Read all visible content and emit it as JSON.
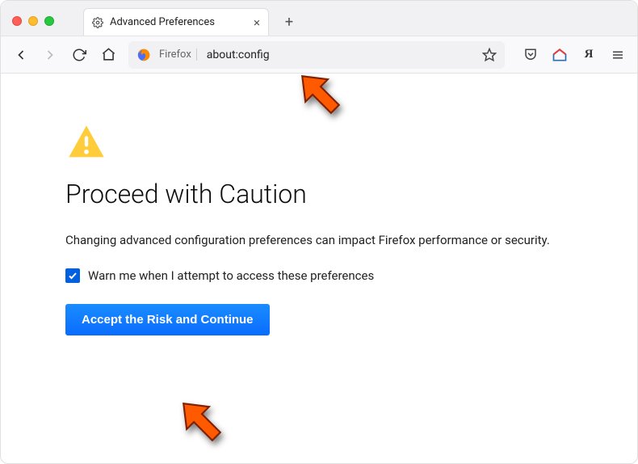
{
  "tab": {
    "title": "Advanced Preferences"
  },
  "urlbar": {
    "browser_label": "Firefox",
    "address": "about:config"
  },
  "page": {
    "heading": "Proceed with Caution",
    "description": "Changing advanced configuration preferences can impact Firefox performance or security.",
    "checkbox_label": "Warn me when I attempt to access these preferences",
    "accept_button": "Accept the Risk and Continue"
  }
}
